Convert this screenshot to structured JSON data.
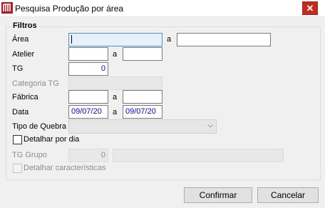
{
  "window": {
    "title": "Pesquisa Produção por área",
    "close_label": "✕"
  },
  "filters": {
    "legend": "Filtros",
    "area": {
      "label": "Área",
      "from_value": "",
      "to_label": "a",
      "to_value": ""
    },
    "atelier": {
      "label": "Atelier",
      "from_value": "",
      "to_label": "a",
      "to_value": ""
    },
    "tg": {
      "label": "TG",
      "value": "0"
    },
    "categoria_tg": {
      "label": "Categoria TG",
      "value": ""
    },
    "fabrica": {
      "label": "Fábrica",
      "from_value": "",
      "to_label": "a",
      "to_value": ""
    },
    "data": {
      "label": "Data",
      "from_value": "09/07/20",
      "to_label": "a",
      "to_value": "09/07/20"
    },
    "tipo_quebra": {
      "label": "Tipo de Quebra",
      "value": ""
    },
    "detalhar_dia": {
      "label": "Detalhar por dia",
      "checked": false
    },
    "tg_grupo": {
      "label": "TG Grupo",
      "value": "0",
      "desc": ""
    },
    "detalhar_caracteristicas": {
      "label": "Detalhar características",
      "checked": false
    }
  },
  "buttons": {
    "confirm": "Confirmar",
    "cancel": "Cancelar"
  }
}
